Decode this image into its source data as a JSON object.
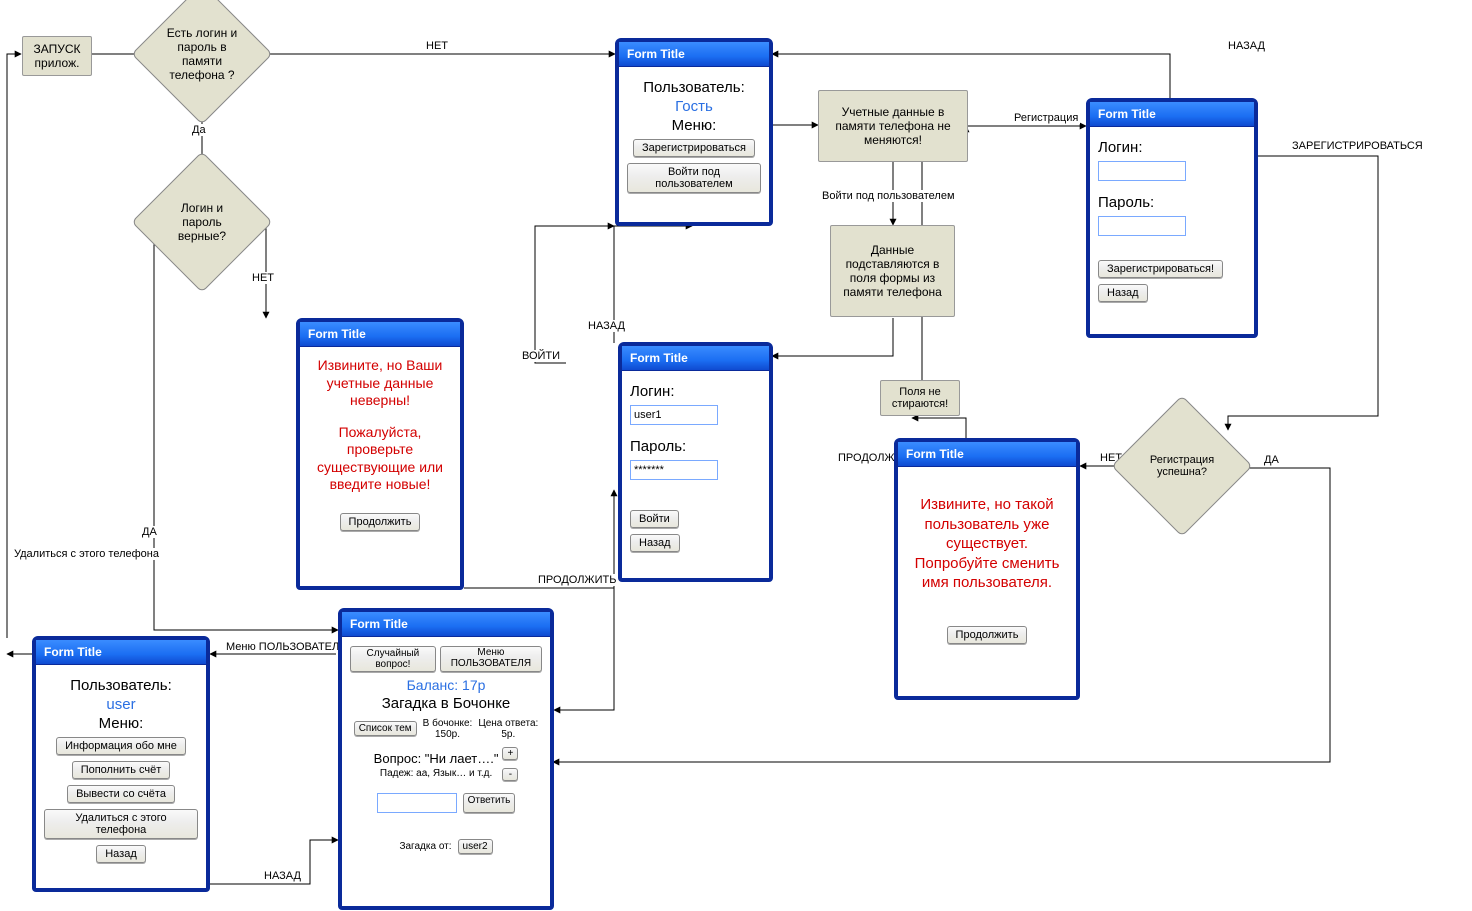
{
  "start_box": "ЗАПУСК прилож.",
  "decision_login_stored": "Есть логин и пароль в памяти телефона ?",
  "decision_login_valid": "Логин и пароль верные?",
  "decision_reg_ok": "Регистрация успешна?",
  "note_credentials_kept": "Учетные данные в памяти телефона не меняются!",
  "note_fill_from_memory": "Данные подставляются в поля формы из памяти телефона",
  "note_fields_keep": "Поля не стираются!",
  "form_title_generic": "Form Title",
  "form_guest": {
    "user_label": "Пользователь:",
    "user_value": "Гость",
    "menu_label": "Меню:",
    "btn_register": "Зарегистрироваться",
    "btn_login_as": "Войти под пользователем"
  },
  "form_register": {
    "login_label": "Логин:",
    "password_label": "Пароль:",
    "btn_register": "Зарегистрироваться!",
    "btn_back": "Назад"
  },
  "form_login": {
    "login_label": "Логин:",
    "login_value": "user1",
    "password_label": "Пароль:",
    "password_value": "*******",
    "btn_login": "Войти",
    "btn_back": "Назад"
  },
  "form_bad_creds": {
    "line1": "Извините, но Ваши учетные данные неверны!",
    "line2": "Пожалуйста, проверьте существующие или введите новые!",
    "btn_continue": "Продолжить"
  },
  "form_user_exists": {
    "msg": "Извините, но такой пользователь уже существует. Попробуйте сменить имя пользователя.",
    "btn_continue": "Продолжить"
  },
  "form_user_menu": {
    "user_label": "Пользователь:",
    "user_value": "user",
    "menu_label": "Меню:",
    "btn_info": "Информация обо мне",
    "btn_topup": "Пополнить счёт",
    "btn_withdraw": "Вывести со счёта",
    "btn_delete": "Удалиться с этого телефона",
    "btn_back": "Назад"
  },
  "form_game": {
    "btn_random": "Случайный вопрос!",
    "btn_user_menu": "Меню ПОЛЬЗОВАТЕЛЯ",
    "balance": "Баланс: 17р",
    "title_main": "Загадка в Бочонке",
    "btn_topics": "Список тем",
    "barrel_label": "В бочонке:",
    "barrel_value": "150р.",
    "price_label": "Цена ответа:",
    "price_value": "5р.",
    "question": "Вопрос: \"Ни лает….\"",
    "hints": "Падеж: аа, Язык… и т.д.",
    "btn_plus": "+",
    "btn_minus": "-",
    "btn_answer": "Ответить",
    "author_label": "Загадка от:",
    "author_value": "user2"
  },
  "edges": {
    "no": "НЕТ",
    "yes": "Да",
    "yes_caps": "ДА",
    "no_caps": "НЕТ",
    "back": "НАЗАД",
    "enter": "ВОЙТИ",
    "continue": "ПРОДОЛЖИТЬ",
    "registration": "Регистрация",
    "login_as": "Войти под пользователем",
    "register_caps": "ЗАРЕГИСТРИРОВАТЬСЯ",
    "delete_from_phone": "Удалиться с этого телефона",
    "user_menu": "Меню ПОЛЬЗОВАТЕЛЯ"
  }
}
